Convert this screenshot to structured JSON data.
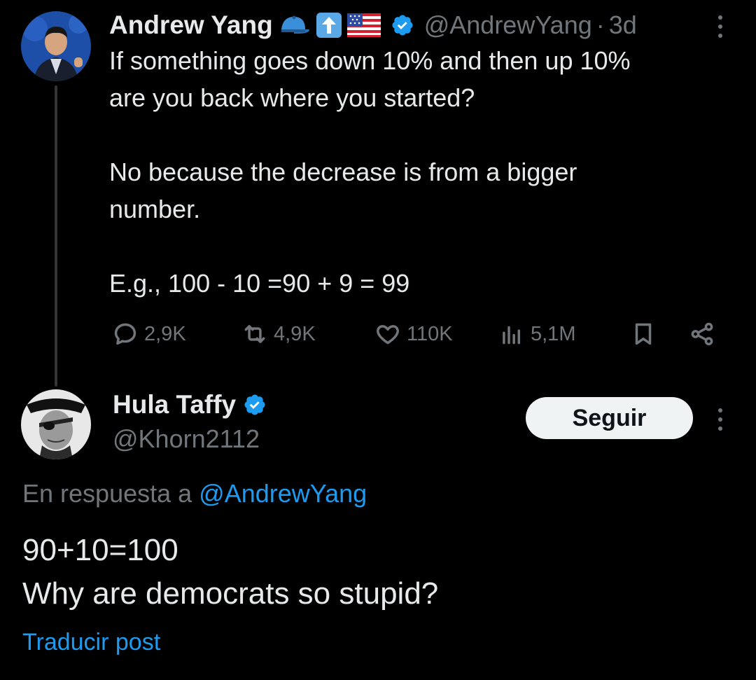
{
  "tweet": {
    "author_name": "Andrew Yang",
    "badges": [
      "cap-emoji",
      "up-arrow-emoji",
      "us-flag-emoji"
    ],
    "handle": "@AndrewYang",
    "separator": "·",
    "time": "3d",
    "lines": [
      "If something goes down 10% and then up 10%",
      "are you back where you started?",
      "No because the decrease is from a bigger",
      "number.",
      "E.g., 100 - 10 =90 + 9 = 99"
    ],
    "metrics": {
      "replies": "2,9K",
      "reposts": "4,9K",
      "likes": "110K",
      "views": "5,1M"
    }
  },
  "reply": {
    "author_name": "Hula Taffy",
    "handle": "@Khorn2112",
    "follow_label": "Seguir",
    "in_reply_prefix": "En respuesta a",
    "in_reply_handle": "@AndrewYang",
    "lines": [
      "90+10=100",
      "Why are democrats so stupid?"
    ],
    "translate_label": "Traducir post"
  },
  "colors": {
    "background": "#000000",
    "text": "#e7e9ea",
    "muted": "#71767b",
    "accent": "#1d9bf0"
  }
}
